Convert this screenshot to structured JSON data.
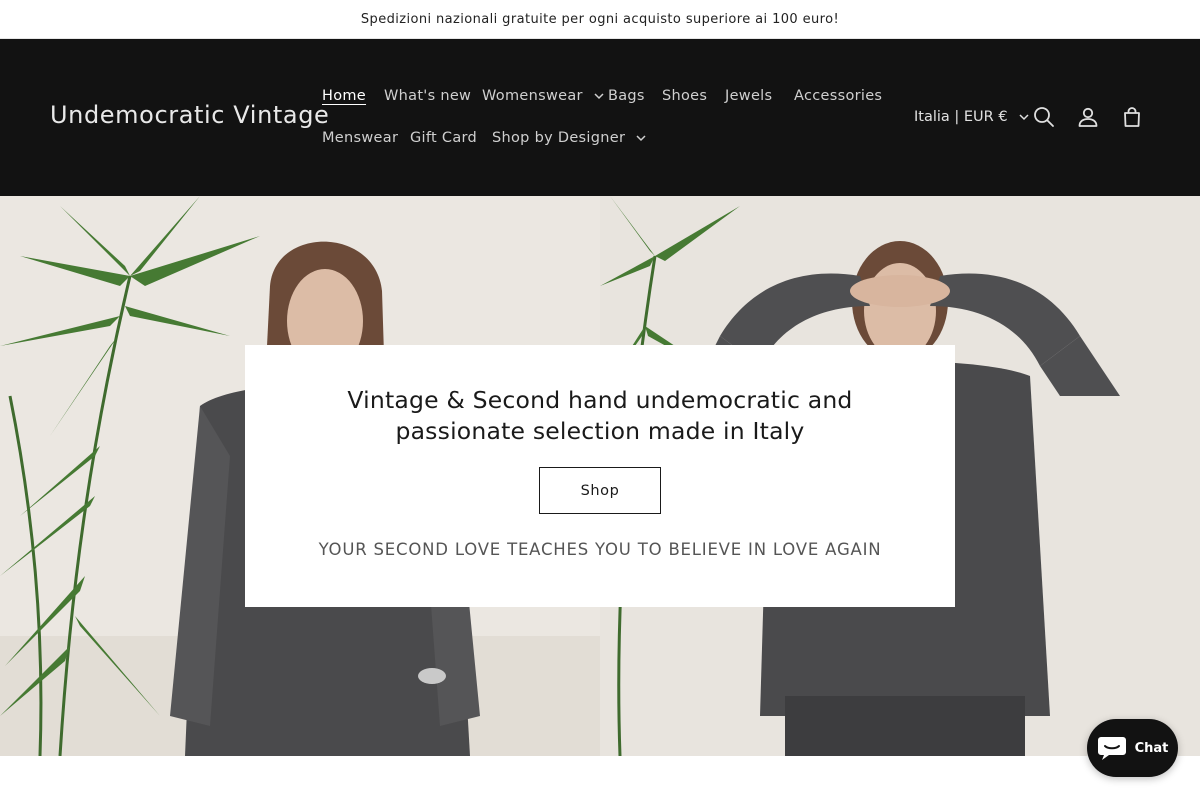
{
  "announcement": {
    "text": "Spedizioni nazionali gratuite per ogni acquisto superiore ai 100 euro!"
  },
  "header": {
    "logo": "Undemocratic Vintage",
    "nav": [
      {
        "label": "Home",
        "active": true
      },
      {
        "label": "What's new"
      },
      {
        "label": "Womenswear",
        "dropdown": true
      },
      {
        "label": "Bags"
      },
      {
        "label": "Shoes"
      },
      {
        "label": "Jewels"
      },
      {
        "label": "Accessories"
      },
      {
        "label": "Menswear"
      },
      {
        "label": "Gift Card"
      },
      {
        "label": "Shop by Designer",
        "dropdown": true
      }
    ],
    "country_selector": "Italia | EUR €",
    "icons": [
      "search-icon",
      "account-icon",
      "cart-icon"
    ]
  },
  "hero": {
    "title": "Vintage & Second hand undemocratic and passionate selection made in Italy",
    "button_label": "Shop",
    "subtitle": "YOUR SECOND LOVE TEACHES YOU TO BELIEVE IN LOVE AGAIN"
  },
  "chat": {
    "label": "Chat"
  },
  "colors": {
    "header_bg": "#121212",
    "page_bg": "#ffffff",
    "accent_text": "#121212"
  }
}
